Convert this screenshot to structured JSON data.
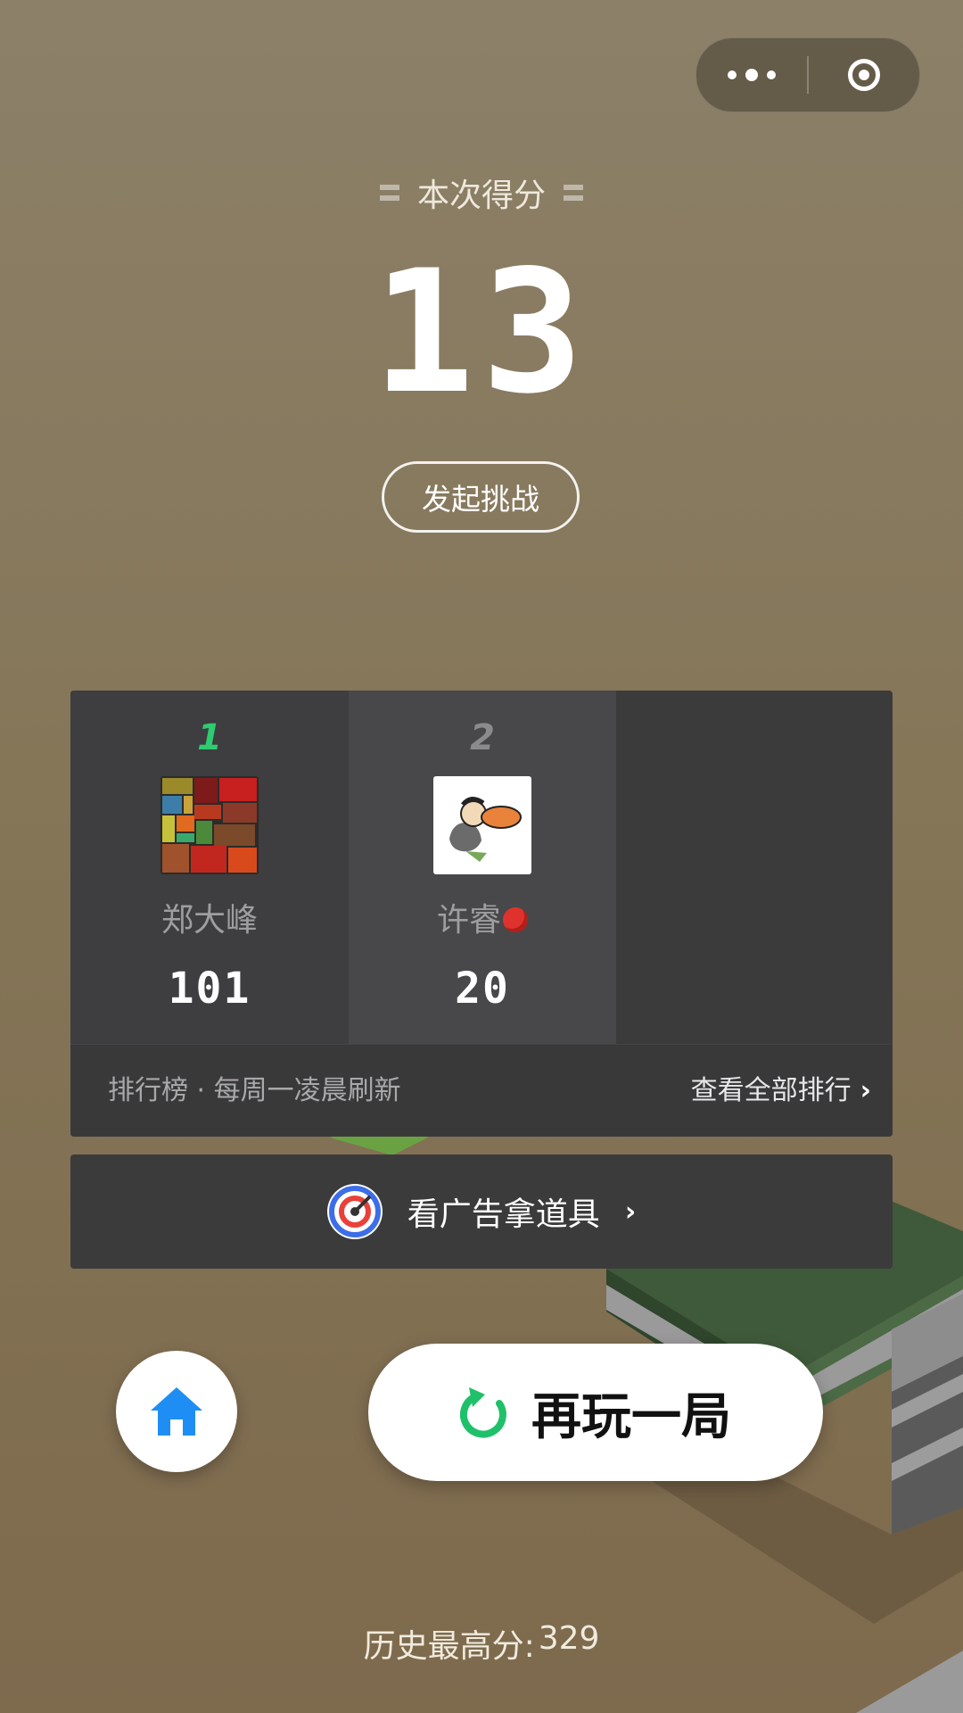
{
  "capsule": {
    "more_icon": "more-dots-icon",
    "close_icon": "target-circle-icon"
  },
  "score": {
    "title": "本次得分",
    "value": "13"
  },
  "challenge_label": "发起挑战",
  "leaderboard": {
    "players": [
      {
        "rank": "1",
        "name": "郑大峰",
        "score": "101",
        "rank_color": "#2ecc71"
      },
      {
        "rank": "2",
        "name": "许睿",
        "score": "20",
        "rank_color": "#8b8a8c"
      }
    ],
    "info": "排行榜 · 每周一凌晨刷新",
    "view_all": "查看全部排行"
  },
  "ad": {
    "label": "看广告拿道具",
    "icon": "dart-target-icon"
  },
  "buttons": {
    "replay": "再玩一局",
    "home_icon": "home-icon",
    "replay_icon": "refresh-icon"
  },
  "best": {
    "label": "历史最高分:",
    "value": "329"
  },
  "colors": {
    "accent_green": "#1fc06a",
    "home_blue": "#1e8ef5",
    "background": "#857658"
  }
}
